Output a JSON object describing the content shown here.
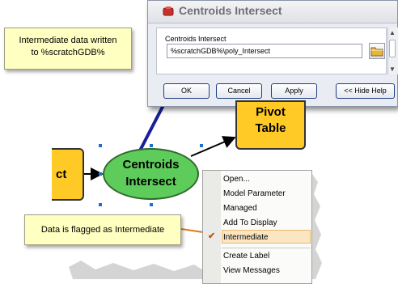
{
  "dialog": {
    "title": "Centroids Intersect",
    "param_label": "Centroids Intersect",
    "param_value": "%scratchGDB%\\poly_Intersect",
    "buttons": {
      "ok": "OK",
      "cancel": "Cancel",
      "apply": "Apply",
      "hide_help": "<< Hide Help"
    }
  },
  "callouts": {
    "top_line1": "Intermediate data written",
    "top_line2": "to %scratchGDB%",
    "bottom": "Data is flagged as Intermediate"
  },
  "nodes": {
    "input_fragment": "ct",
    "tool": [
      "Centroids",
      "Intersect"
    ],
    "output": [
      "Pivot",
      "Table"
    ]
  },
  "menu": {
    "items": [
      "Open...",
      "Model Parameter",
      "Managed",
      "Add To Display",
      "Intermediate",
      "Create Label",
      "View Messages"
    ],
    "checked_item": "Intermediate"
  },
  "colors": {
    "accent_arrow": "#17209a",
    "tool_fill": "#5ecc5a",
    "data_fill": "#ffc926",
    "callout_fill": "#ffffc2",
    "menu_highlight": "#fbe6c2"
  }
}
